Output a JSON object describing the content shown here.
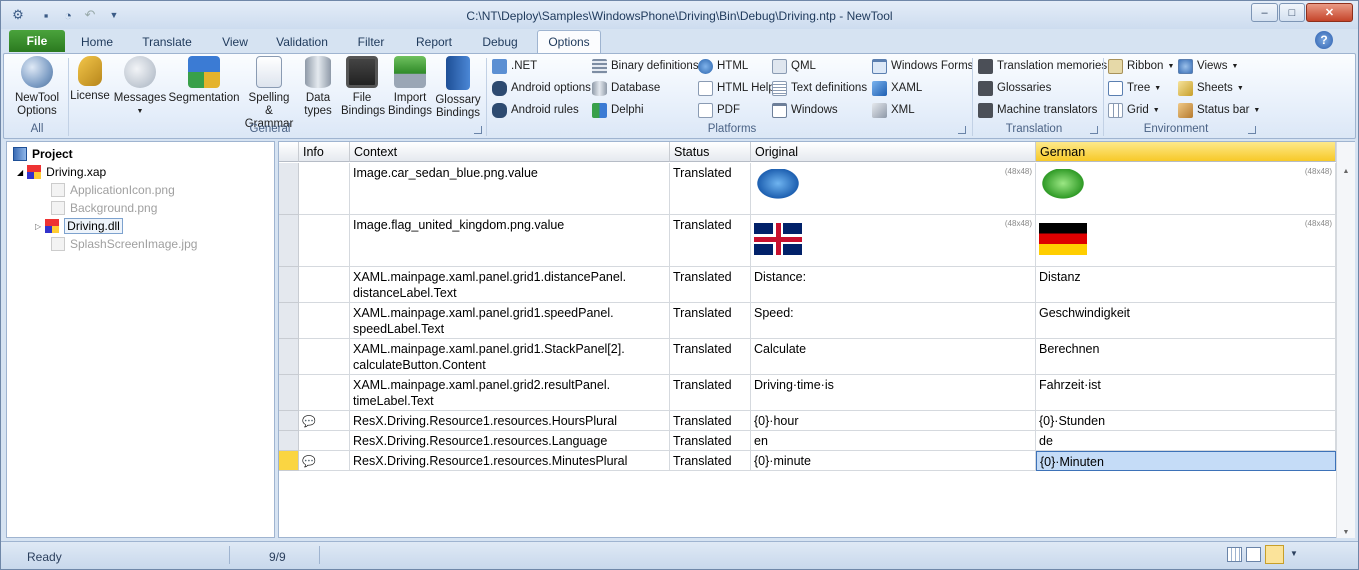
{
  "app": {
    "title": "C:\\NT\\Deploy\\Samples\\WindowsPhone\\Driving\\Bin\\Debug\\Driving.ntp - NewTool"
  },
  "window_buttons": {
    "minimize": "–",
    "maximize": "□",
    "close": "✕"
  },
  "tabs": {
    "file": "File",
    "home": "Home",
    "translate": "Translate",
    "view": "View",
    "validation": "Validation",
    "filter": "Filter",
    "report": "Report",
    "debug": "Debug",
    "options": "Options"
  },
  "help": "?",
  "ribbon": {
    "all": {
      "newtool": "NewTool Options",
      "group": "All"
    },
    "general": {
      "license": "License",
      "messages": "Messages",
      "segmentation": "Segmentation",
      "spelling": "Spelling & Grammar",
      "datatypes": "Data types",
      "filebindings": "File Bindings",
      "importbindings": "Import Bindings",
      "glossarybindings": "Glossary Bindings",
      "group": "General"
    },
    "platforms": {
      "net": ".NET",
      "android_options": "Android options",
      "android_rules": "Android rules",
      "binary": "Binary definitions",
      "database": "Database",
      "delphi": "Delphi",
      "html": "HTML",
      "htmlhelp": "HTML Help",
      "pdf": "PDF",
      "qml": "QML",
      "textdefs": "Text definitions",
      "windows": "Windows",
      "winforms": "Windows Forms",
      "xaml": "XAML",
      "xml": "XML",
      "group": "Platforms"
    },
    "translation": {
      "memories": "Translation memories",
      "glossaries": "Glossaries",
      "machine": "Machine translators",
      "group": "Translation"
    },
    "environment": {
      "ribbon": "Ribbon",
      "tree": "Tree",
      "grid": "Grid",
      "views": "Views",
      "sheets": "Sheets",
      "statusbar": "Status bar",
      "group": "Environment"
    }
  },
  "tree": {
    "root": "Project",
    "xap": "Driving.xap",
    "appicon": "ApplicationIcon.png",
    "background": "Background.png",
    "dll": "Driving.dll",
    "splash": "SplashScreenImage.jpg"
  },
  "grid": {
    "headers": {
      "info": "Info",
      "context": "Context",
      "status": "Status",
      "original": "Original",
      "german": "German"
    },
    "rows": [
      {
        "context": "Image.car_sedan_blue.png.value",
        "status": "Translated",
        "original": "",
        "german": "",
        "size": "(48x48)"
      },
      {
        "context": "Image.flag_united_kingdom.png.value",
        "status": "Translated",
        "original": "",
        "german": "",
        "size": "(48x48)"
      },
      {
        "context": "XAML.mainpage.xaml.panel.grid1.distancePanel.\ndistanceLabel.Text",
        "status": "Translated",
        "original": "Distance:",
        "german": "Distanz"
      },
      {
        "context": "XAML.mainpage.xaml.panel.grid1.speedPanel.\nspeedLabel.Text",
        "status": "Translated",
        "original": "Speed:",
        "german": "Geschwindigkeit"
      },
      {
        "context": "XAML.mainpage.xaml.panel.grid1.StackPanel[2].\ncalculateButton.Content",
        "status": "Translated",
        "original": "Calculate",
        "german": "Berechnen"
      },
      {
        "context": "XAML.mainpage.xaml.panel.grid2.resultPanel.\ntimeLabel.Text",
        "status": "Translated",
        "original": "Driving·time·is",
        "german": "Fahrzeit·ist"
      },
      {
        "context": "ResX.Driving.Resource1.resources.HoursPlural",
        "status": "Translated",
        "original": "{0}·hour",
        "german": "{0}·Stunden"
      },
      {
        "context": "ResX.Driving.Resource1.resources.Language",
        "status": "Translated",
        "original": "en",
        "german": "de"
      },
      {
        "context": "ResX.Driving.Resource1.resources.MinutesPlural",
        "status": "Translated",
        "original": "{0}·minute",
        "german": "{0}·Minuten"
      }
    ]
  },
  "status": {
    "ready": "Ready",
    "count": "9/9"
  },
  "colors": {
    "accent": "#fad542",
    "selection": "#c5dcf7"
  }
}
